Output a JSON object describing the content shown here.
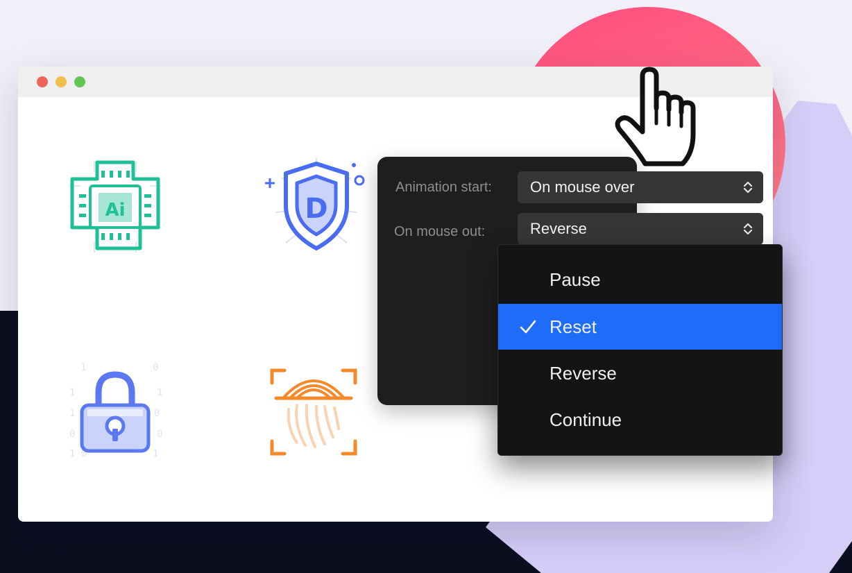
{
  "settings": {
    "animation_start_label": "Animation start:",
    "animation_start_value": "On mouse over",
    "mouse_out_label": "On mouse out:",
    "mouse_out_value": "Reverse"
  },
  "dropdown": {
    "options": [
      {
        "label": "Pause",
        "selected": false
      },
      {
        "label": "Reset",
        "selected": true
      },
      {
        "label": "Reverse",
        "selected": false
      },
      {
        "label": "Continue",
        "selected": false
      }
    ]
  },
  "icons": {
    "ai_chip_text": "Ai",
    "shield_letter": "D"
  },
  "colors": {
    "accent_selected": "#1e6cf8",
    "circle": "#ff5a80",
    "ai_chip": "#1fbf98",
    "shield": "#4a6cf0",
    "lock": "#5b78f0",
    "fingerprint": "#f58a2c"
  }
}
